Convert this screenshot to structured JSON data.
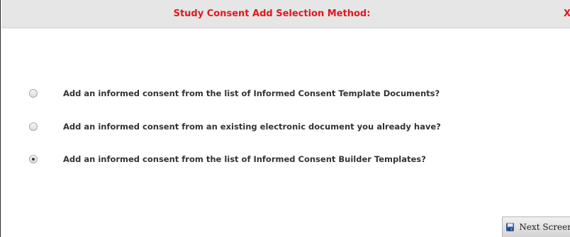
{
  "dialog": {
    "title": "Study Consent Add Selection Method:",
    "close_label": "X"
  },
  "options": [
    {
      "label": "Add an informed consent from the list of Informed Consent Template Documents?",
      "selected": false
    },
    {
      "label": "Add an informed consent from an existing electronic document you already have?",
      "selected": false
    },
    {
      "label": "Add an informed consent from the list of Informed Consent Builder Templates?",
      "selected": true
    }
  ],
  "footer": {
    "next_label": "Next Screen",
    "next_icon": "floppy-disk-icon"
  },
  "colors": {
    "title": "#e0191f",
    "titlebar_bg": "#e6e6e6",
    "option_text": "#333333"
  }
}
